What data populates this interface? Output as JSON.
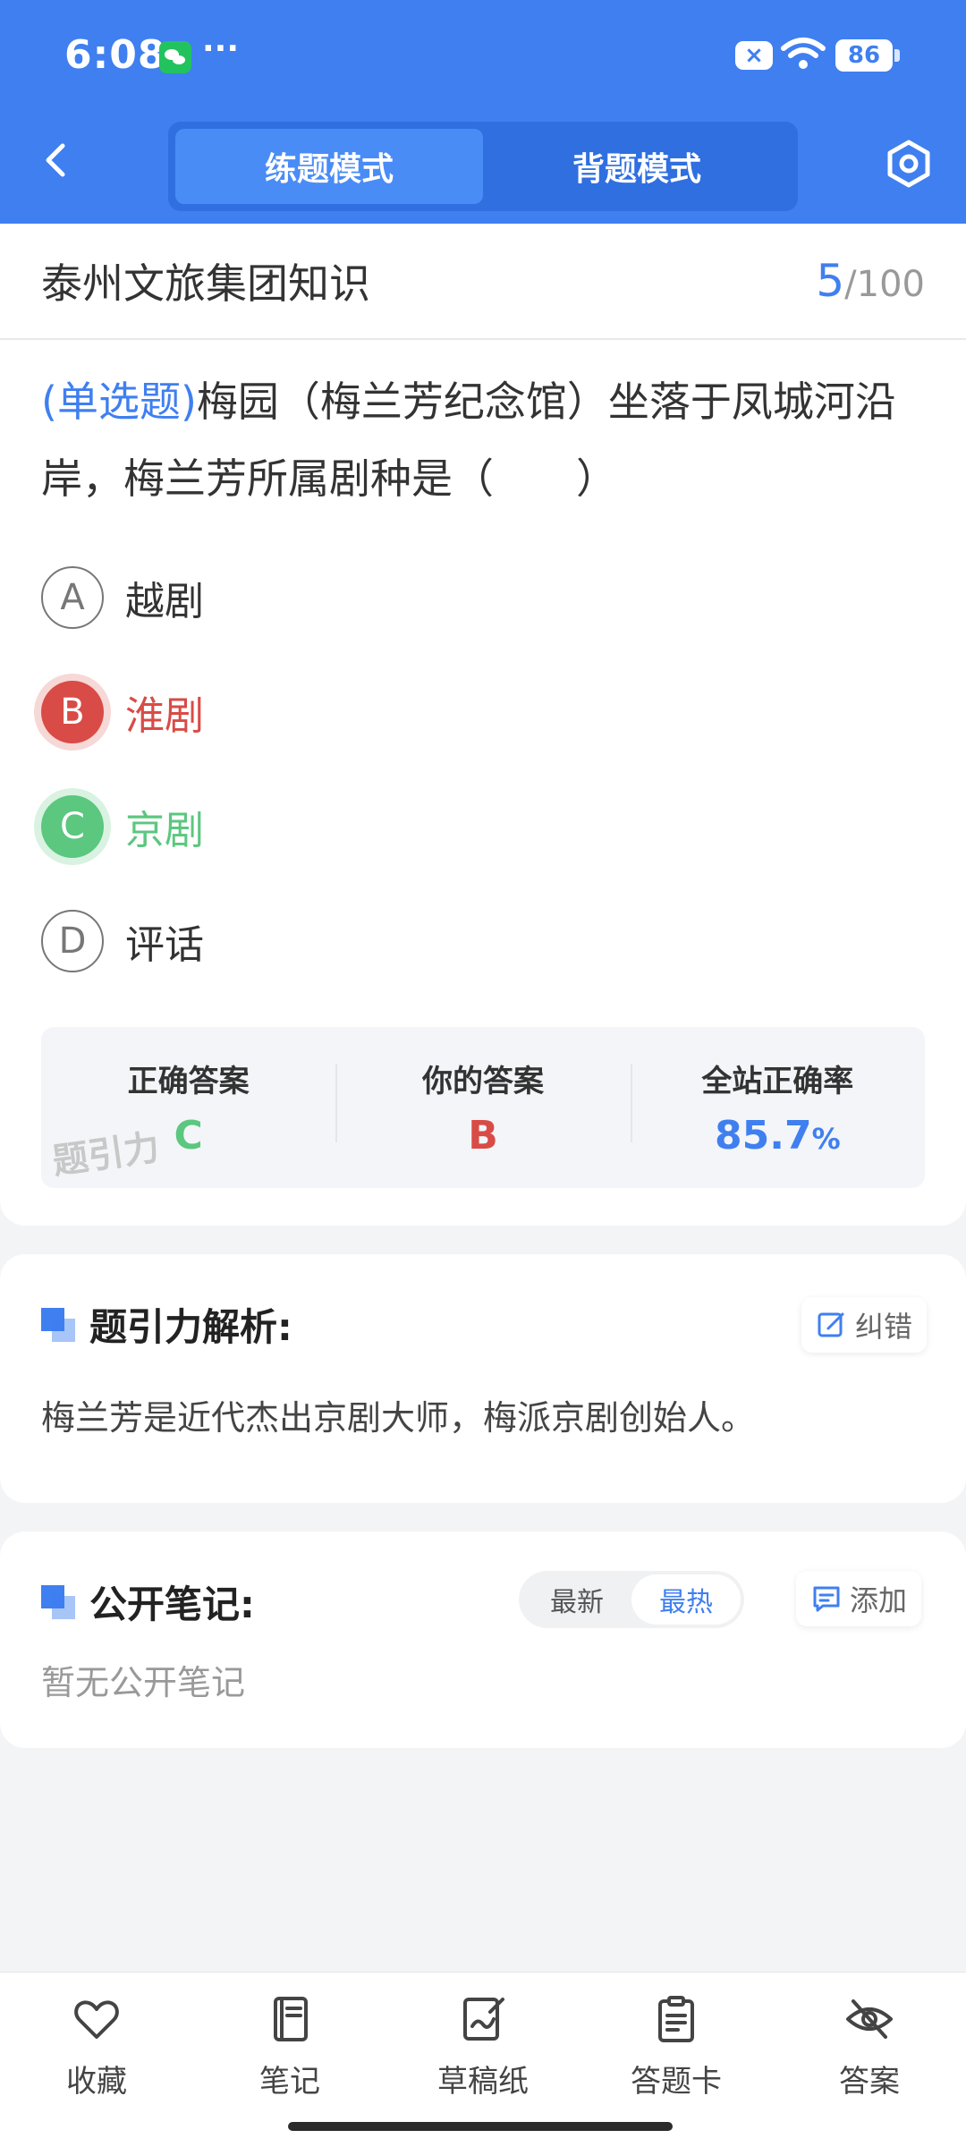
{
  "status_bar": {
    "time": "6:08",
    "dots": "···",
    "battery": "86"
  },
  "header": {
    "modes": [
      {
        "label": "练题模式",
        "active": true
      },
      {
        "label": "背题模式",
        "active": false
      }
    ]
  },
  "bank": {
    "title": "泰州文旅集团知识",
    "current": "5",
    "separator": "/",
    "total": "100"
  },
  "question": {
    "type": "(单选题)",
    "text": "梅园（梅兰芳纪念馆）坐落于凤城河沿岸，梅兰芳所属剧种是（　　）"
  },
  "options": [
    {
      "letter": "A",
      "text": "越剧",
      "state": "normal"
    },
    {
      "letter": "B",
      "text": "淮剧",
      "state": "wrong"
    },
    {
      "letter": "C",
      "text": "京剧",
      "state": "right"
    },
    {
      "letter": "D",
      "text": "评话",
      "state": "normal"
    }
  ],
  "answer_summary": {
    "correct_label": "正确答案",
    "correct_value": "C",
    "yours_label": "你的答案",
    "yours_value": "B",
    "rate_label": "全站正确率",
    "rate_value": "85.7",
    "rate_unit": "%",
    "watermark": "题引力"
  },
  "analysis": {
    "title": "题引力解析:",
    "correct_btn": "纠错",
    "text": "梅兰芳是近代杰出京剧大师，梅派京剧创始人。"
  },
  "notes": {
    "title": "公开笔记:",
    "sort_latest": "最新",
    "sort_hot": "最热",
    "add_btn": "添加",
    "empty": "暂无公开笔记"
  },
  "bottom_nav": [
    {
      "label": "收藏",
      "icon": "heart-icon"
    },
    {
      "label": "笔记",
      "icon": "notebook-icon"
    },
    {
      "label": "草稿纸",
      "icon": "draft-icon"
    },
    {
      "label": "答题卡",
      "icon": "answer-card-icon"
    },
    {
      "label": "答案",
      "icon": "eye-off-icon"
    }
  ],
  "colors": {
    "primary": "#3f7ff0",
    "wrong": "#d94b46",
    "right": "#5bc77f"
  }
}
